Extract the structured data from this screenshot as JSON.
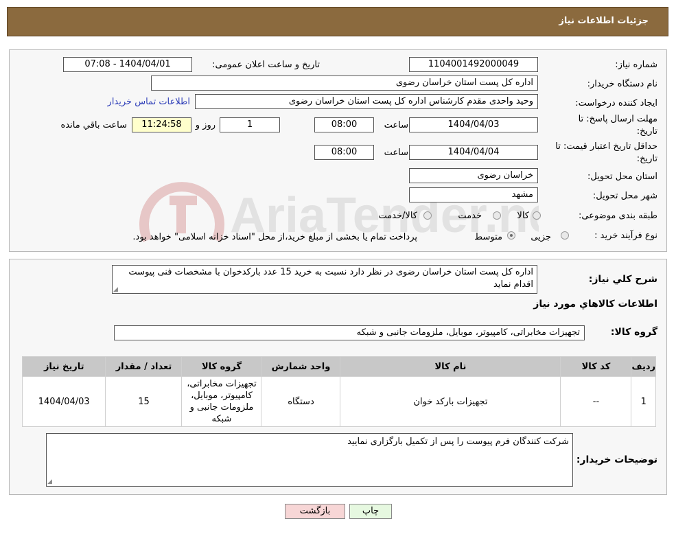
{
  "header": {
    "title": "جزئیات اطلاعات نیاز"
  },
  "form": {
    "need_number_label": "شماره نیاز:",
    "need_number": "1104001492000049",
    "announce_label": "تاریخ و ساعت اعلان عمومی:",
    "announce_value": "1404/04/01 - 07:08",
    "buyer_org_label": "نام دستگاه خریدار:",
    "buyer_org": "اداره کل پست استان خراسان رضوی",
    "creator_label": "ایجاد کننده درخواست:",
    "creator": "وحید واحدی مقدم کارشناس اداره کل پست استان خراسان رضوی",
    "contact_link": "اطلاعات تماس خریدار",
    "deadline_label_1": "مهلت ارسال پاسخ: تا",
    "deadline_label_2": "تاریخ:",
    "deadline_date": "1404/04/03",
    "time_label": "ساعت",
    "deadline_time": "08:00",
    "days_value": "1",
    "days_label": "روز و",
    "remaining_time": "11:24:58",
    "remaining_label": "ساعت باقي مانده",
    "validity_label_1": "حداقل تاریخ اعتبار قیمت: تا",
    "validity_label_2": "تاریخ:",
    "validity_date": "1404/04/04",
    "validity_time": "08:00",
    "province_label": "استان محل تحویل:",
    "province": "خراسان رضوی",
    "city_label": "شهر محل تحویل:",
    "city": "مشهد",
    "category_label": "طبقه بندی موضوعی:",
    "category_options": [
      "کالا",
      "خدمت",
      "کالا/خدمت"
    ],
    "purchase_type_label": "نوع فرآیند خرید :",
    "purchase_options": [
      "جزیی",
      "متوسط"
    ],
    "purchase_note": "پرداخت تمام یا بخشی از مبلغ خرید،از محل \"اسناد خزانه اسلامی\" خواهد بود."
  },
  "watermark": {
    "text": "AriaTender.net"
  },
  "summary": {
    "description_label": "شرح کلي نياز:",
    "description": "اداره کل پست استان خراسان رضوی در نظر دارد نسبت به خرید 15 عدد بارکدخوان با مشخصات فنی پیوست اقدام نماید",
    "items_title": "اطلاعات کالاهاي مورد نياز",
    "group_label": "گروه کالا:",
    "group_value": "تجهیزات مخابراتی، کامپیوتر، موبایل، ملزومات جانبی و شبکه"
  },
  "table": {
    "headers": [
      "رديف",
      "کد کالا",
      "نام کالا",
      "واحد شمارش",
      "گروه کالا",
      "تعداد / مقدار",
      "تاریخ نیاز"
    ],
    "rows": [
      [
        "1",
        "--",
        "تجهیزات بارکد خوان",
        "دستگاه",
        "تجهیزات مخابراتی، کامپیوتر، موبایل، ملزومات جانبی و شبکه",
        "15",
        "1404/04/03"
      ]
    ]
  },
  "buyer_notes": {
    "label": "توضیحات خریدار:",
    "text": "شرکت کنندگان فرم پیوست را پس از تکمیل بارگزاری نمایید"
  },
  "buttons": {
    "print": "چاپ",
    "back": "بازگشت"
  },
  "colors": {
    "header": "#8b6a3e",
    "print_button": "#e6f8e0",
    "back_button": "#f7d6d6",
    "link": "#2e3eb8",
    "remaining_bg": "#ffffcc"
  }
}
